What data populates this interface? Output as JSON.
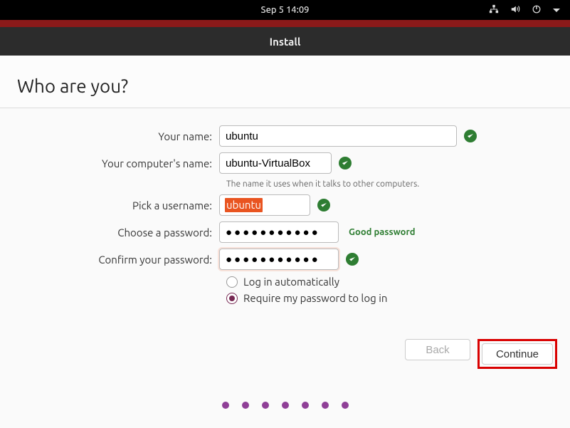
{
  "topbar": {
    "clock": "Sep 5  14:09"
  },
  "window": {
    "title": "Install"
  },
  "header": {
    "title": "Who are you?"
  },
  "form": {
    "name_label": "Your name:",
    "name_value": "ubuntu",
    "host_label": "Your computer's name:",
    "host_value": "ubuntu-VirtualBox",
    "host_hint": "The name it uses when it talks to other computers.",
    "user_label": "Pick a username:",
    "user_value": "ubuntu",
    "pw_label": "Choose a password:",
    "pw_value": "●●●●●●●●●●●",
    "pw_feedback": "Good password",
    "pw2_label": "Confirm your password:",
    "pw2_value": "●●●●●●●●●●●",
    "radio_auto": "Log in automatically",
    "radio_require": "Require my password to log in"
  },
  "buttons": {
    "back": "Back",
    "continue": "Continue"
  }
}
